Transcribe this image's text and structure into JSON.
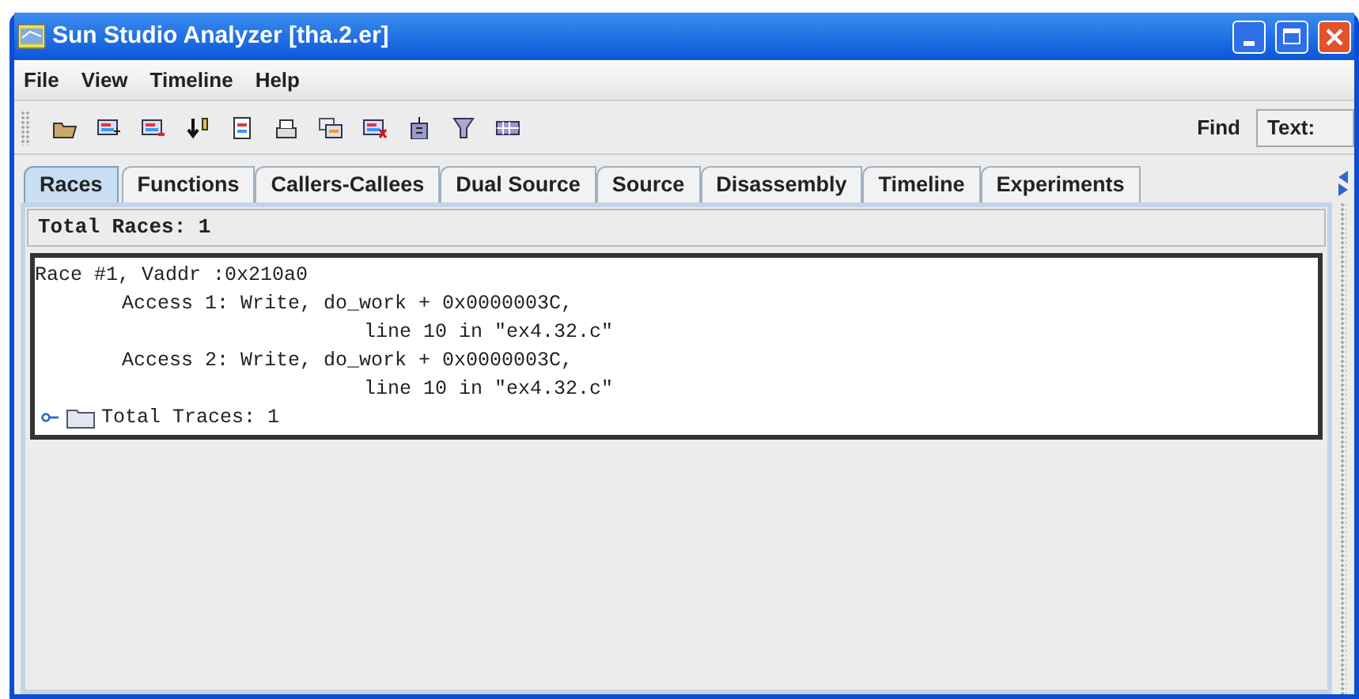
{
  "window": {
    "title": "Sun Studio Analyzer [tha.2.er]"
  },
  "menu": [
    "File",
    "View",
    "Timeline",
    "Help"
  ],
  "find": {
    "label": "Find",
    "field_label": "Text:"
  },
  "tabs": [
    {
      "label": "Races",
      "selected": true
    },
    {
      "label": "Functions",
      "selected": false
    },
    {
      "label": "Callers-Callees",
      "selected": false
    },
    {
      "label": "Dual Source",
      "selected": false
    },
    {
      "label": "Source",
      "selected": false
    },
    {
      "label": "Disassembly",
      "selected": false
    },
    {
      "label": "Timeline",
      "selected": false
    },
    {
      "label": "Experiments",
      "selected": false
    }
  ],
  "summary": "Total Races: 1",
  "race": {
    "header": "Race #1, Vaddr :0x210a0",
    "accesses": [
      {
        "text": "Access 1: Write, do_work + 0x0000003C,",
        "location": "line 10 in \"ex4.32.c\""
      },
      {
        "text": "Access 2: Write, do_work + 0x0000003C,",
        "location": "line 10 in \"ex4.32.c\""
      }
    ],
    "traces": {
      "label": "Total Traces: 1",
      "expanded": false
    }
  }
}
